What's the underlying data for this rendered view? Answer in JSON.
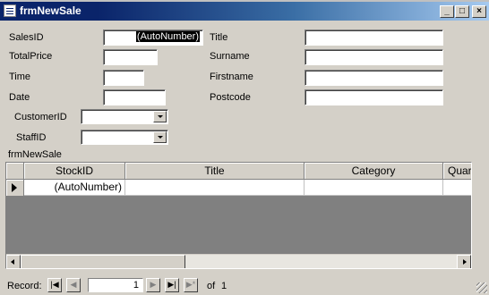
{
  "window": {
    "title": "frmNewSale",
    "minimize": "_",
    "maximize": "□",
    "close": "×"
  },
  "form": {
    "left_fields": [
      {
        "label": "SalesID",
        "value": "(AutoNumber)"
      },
      {
        "label": "TotalPrice",
        "value": ""
      },
      {
        "label": "Time",
        "value": ""
      },
      {
        "label": "Date",
        "value": ""
      }
    ],
    "right_fields": [
      {
        "label": "Title",
        "value": ""
      },
      {
        "label": "Surname",
        "value": ""
      },
      {
        "label": "Firstname",
        "value": ""
      },
      {
        "label": "Postcode",
        "value": ""
      }
    ],
    "combos": [
      {
        "label": "CustomerID",
        "value": ""
      },
      {
        "label": "StaffID",
        "value": ""
      }
    ]
  },
  "subform": {
    "label": "frmNewSale",
    "columns": [
      "StockID",
      "Title",
      "Category",
      "Quar"
    ],
    "rows": [
      [
        "(AutoNumber)",
        "",
        "",
        ""
      ]
    ]
  },
  "navigation": {
    "record_label": "Record:",
    "first": "|◀",
    "prev": "◀",
    "current": "1",
    "next": "▶",
    "last": "▶|",
    "new": "▶*",
    "of_label": "of",
    "total": "1"
  }
}
